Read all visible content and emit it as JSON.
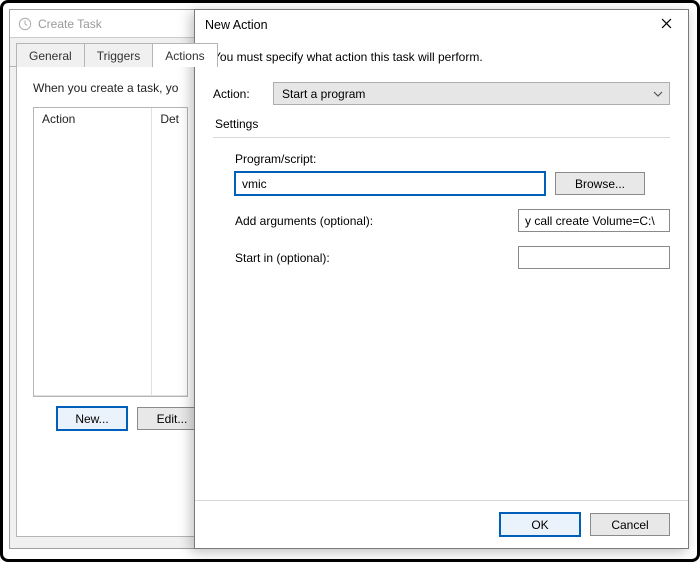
{
  "bg": {
    "title": "Create Task",
    "tabs": {
      "general": "General",
      "triggers": "Triggers",
      "actions": "Actions"
    },
    "intro": "When you create a task, yo",
    "columns": {
      "action": "Action",
      "details": "Det"
    },
    "buttons": {
      "new": "New...",
      "edit": "Edit..."
    }
  },
  "fg": {
    "title": "New Action",
    "instruction": "You must specify what action this task will perform.",
    "action_label": "Action:",
    "action_value": "Start a program",
    "settings_label": "Settings",
    "program_label": "Program/script:",
    "program_value": "vmic",
    "browse": "Browse...",
    "args_label": "Add arguments (optional):",
    "args_value": "y call create Volume=C:\\",
    "startin_label": "Start in (optional):",
    "startin_value": "",
    "ok": "OK",
    "cancel": "Cancel"
  }
}
